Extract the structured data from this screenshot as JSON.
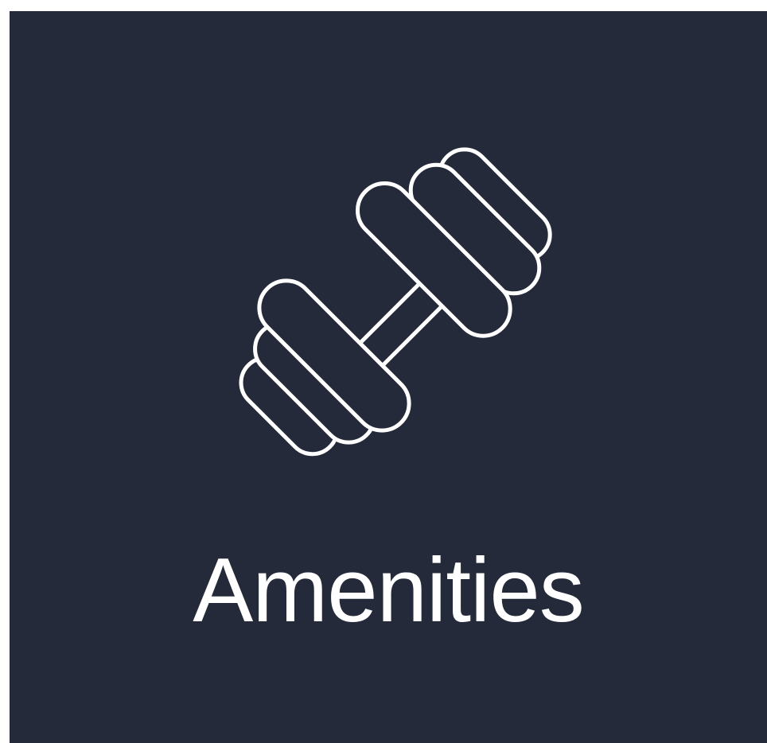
{
  "tile": {
    "label": "Amenities",
    "icon": "dumbbell-icon",
    "background_color": "#252a3a",
    "foreground_color": "#ffffff"
  }
}
